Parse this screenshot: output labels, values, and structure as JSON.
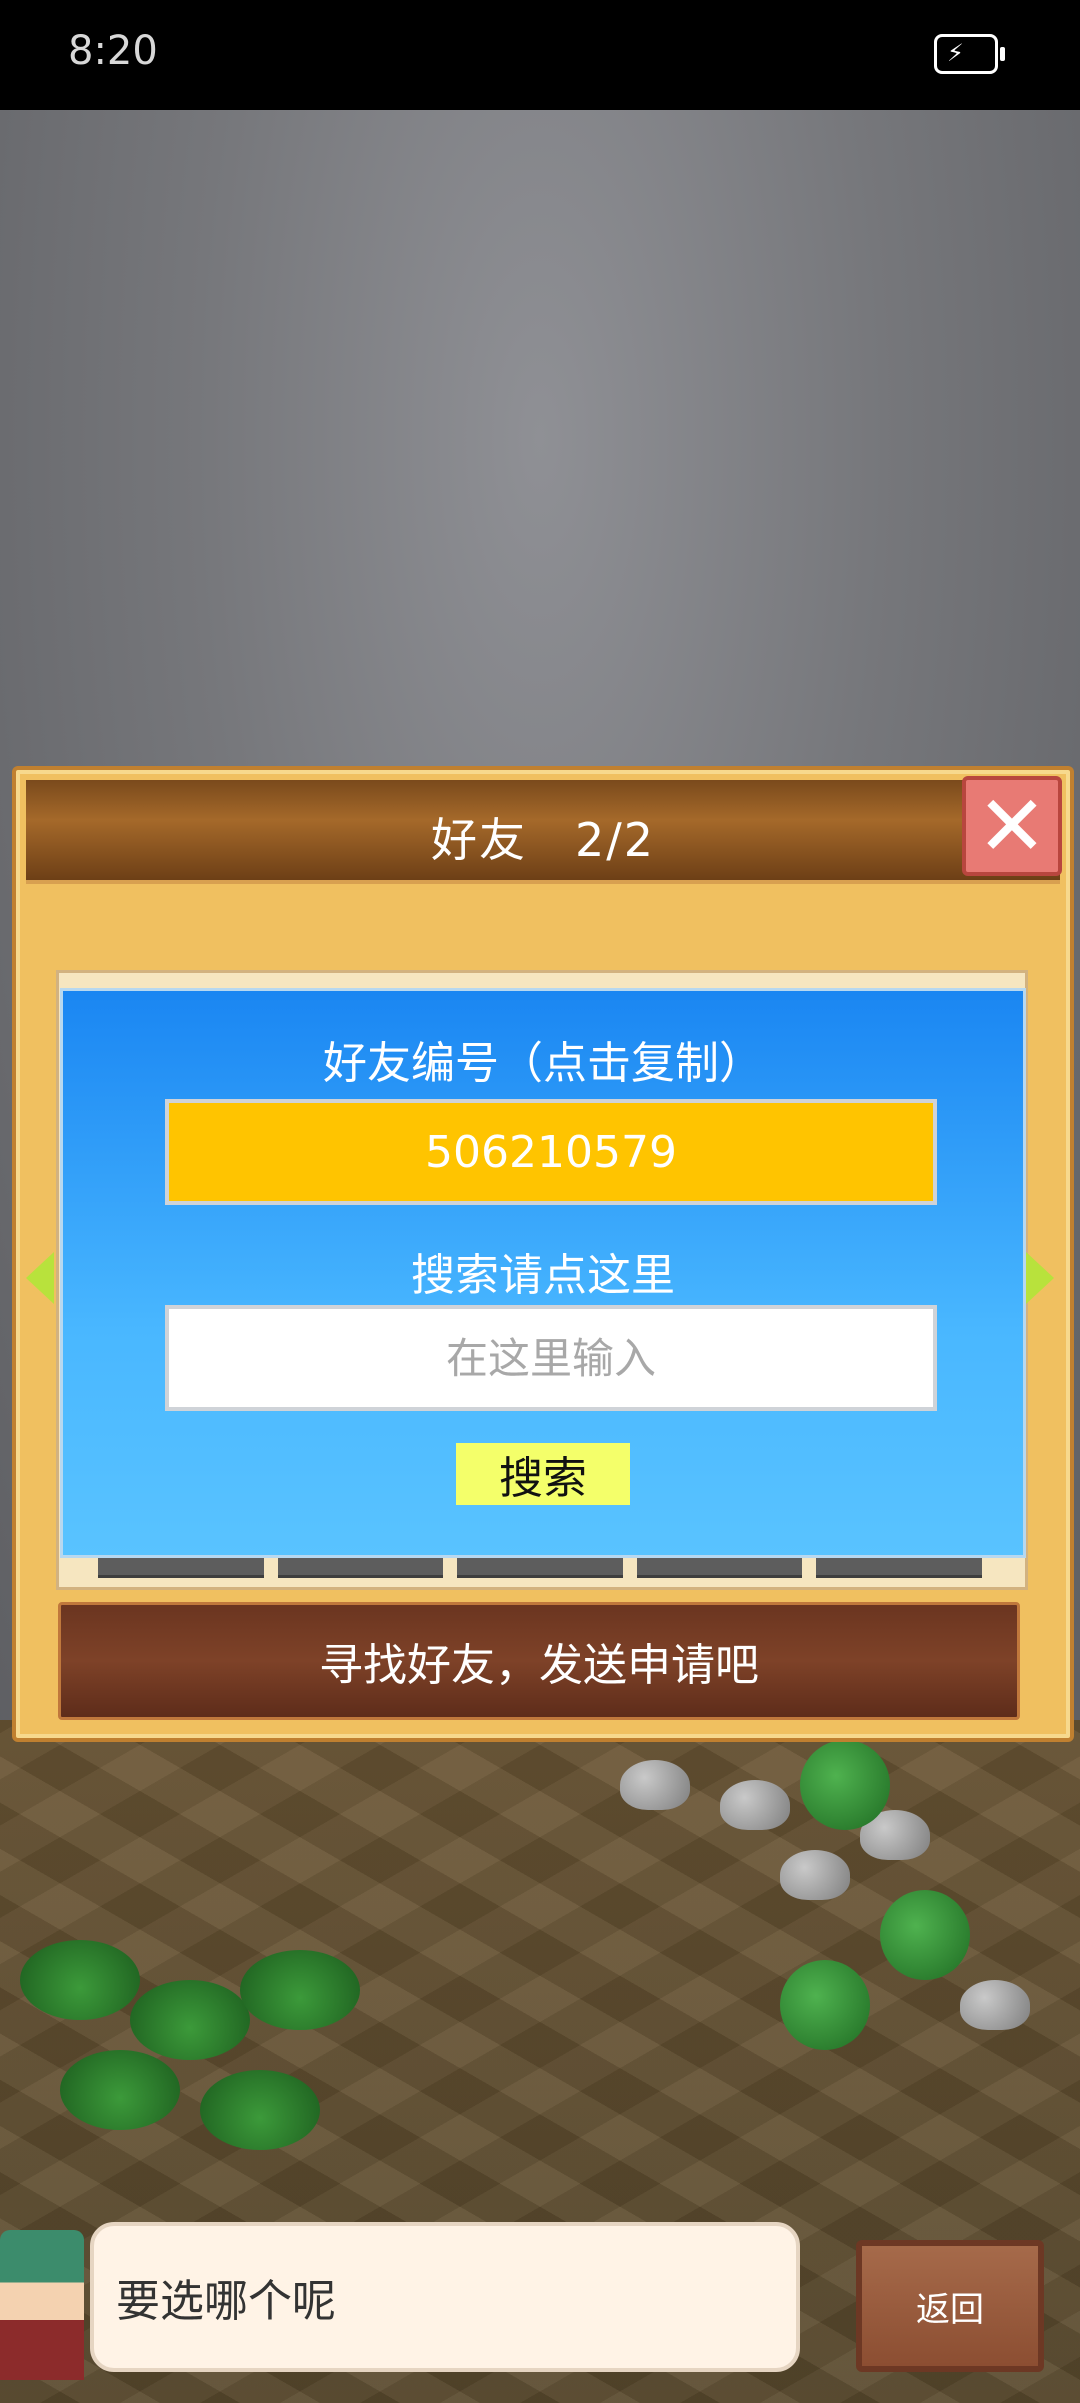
{
  "status_bar": {
    "time": "8:20"
  },
  "dialog": {
    "title": "好友　2/2",
    "panel": {
      "friend_id_label": "好友编号（点击复制）",
      "friend_id_value": "506210579",
      "search_label": "搜索请点这里",
      "search_placeholder": "在这里输入",
      "search_button": "搜索"
    },
    "info_bar": "寻找好友，发送申请吧"
  },
  "bottom": {
    "speech": "要选哪个呢",
    "back_button": "返回"
  }
}
